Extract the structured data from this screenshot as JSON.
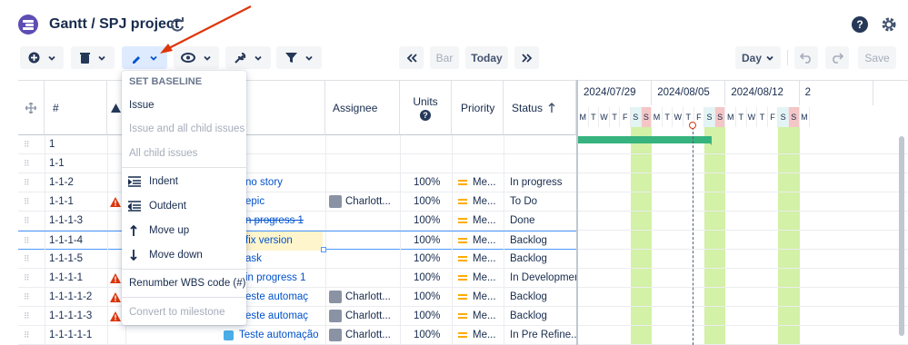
{
  "app": {
    "title": "Gantt / SPJ project"
  },
  "toolbar": {
    "today_label": "Today",
    "bar_label": "Bar",
    "zoom_label": "Day",
    "save_label": "Save"
  },
  "menu": {
    "section_title": "SET BASELINE",
    "items": [
      {
        "label": "Issue",
        "enabled": true
      },
      {
        "label": "Issue and all child issues",
        "enabled": false
      },
      {
        "label": "All child issues",
        "enabled": false
      },
      {
        "label": "Indent",
        "enabled": true,
        "icon": "indent-icon"
      },
      {
        "label": "Outdent",
        "enabled": true,
        "icon": "outdent-icon"
      },
      {
        "label": "Move up",
        "enabled": true,
        "icon": "arrow-up-icon"
      },
      {
        "label": "Move down",
        "enabled": true,
        "icon": "arrow-down-icon"
      },
      {
        "label": "Renumber WBS code (#)",
        "enabled": true
      },
      {
        "label": "Convert to milestone",
        "enabled": false
      }
    ]
  },
  "columns": {
    "num": "#",
    "assignee": "Assignee",
    "units": "Units",
    "priority": "Priority",
    "status": "Status"
  },
  "rows": [
    {
      "wbs": "1",
      "warn": false,
      "title": "",
      "assignee": "",
      "units": "",
      "priority": "",
      "status": ""
    },
    {
      "wbs": "1-1",
      "warn": false,
      "title": "",
      "assignee": "",
      "units": "",
      "priority": "",
      "status": ""
    },
    {
      "wbs": "1-1-2",
      "warn": false,
      "title": "no story",
      "assignee": "",
      "units": "100%",
      "priority": "Me...",
      "status": "In progress"
    },
    {
      "wbs": "1-1-1",
      "warn": true,
      "title": "epic",
      "assignee": "Charlott...",
      "units": "100%",
      "priority": "Me...",
      "status": "To Do"
    },
    {
      "wbs": "1-1-1-3",
      "warn": false,
      "title": "n progress 1",
      "strike": true,
      "assignee": "",
      "units": "100%",
      "priority": "Me...",
      "status": "Done"
    },
    {
      "wbs": "1-1-1-4",
      "warn": false,
      "title": "fix version",
      "assignee": "",
      "units": "100%",
      "priority": "Me...",
      "status": "Backlog"
    },
    {
      "wbs": "1-1-1-5",
      "warn": false,
      "title": "ask",
      "assignee": "",
      "units": "100%",
      "priority": "Me...",
      "status": "Backlog"
    },
    {
      "wbs": "1-1-1-1",
      "warn": true,
      "title": "in progress 1",
      "assignee": "",
      "units": "100%",
      "priority": "Me...",
      "status": "In Developmen"
    },
    {
      "wbs": "1-1-1-1-2",
      "warn": true,
      "title": "este automaç",
      "assignee": "Charlott...",
      "units": "100%",
      "priority": "Me...",
      "status": "Backlog"
    },
    {
      "wbs": "1-1-1-1-3",
      "warn": true,
      "title": "este automaç",
      "assignee": "Charlott...",
      "units": "100%",
      "priority": "Me...",
      "status": "Backlog"
    },
    {
      "wbs": "1-1-1-1-1",
      "warn": false,
      "title": "Teste automação",
      "assignee": "Charlott...",
      "units": "100%",
      "priority": "Me...",
      "status": "In Pre Refine..."
    }
  ],
  "gantt": {
    "weeks": [
      "2024/07/29",
      "2024/08/05",
      "2024/08/12",
      "2"
    ],
    "days": [
      "M",
      "T",
      "W",
      "T",
      "F",
      "S",
      "S",
      "M",
      "T",
      "W",
      "T",
      "F",
      "S",
      "S",
      "M",
      "T",
      "W",
      "T",
      "F",
      "S",
      "S",
      "M"
    ]
  },
  "colors": {
    "accent": "#0052cc",
    "weekend_a": "#d3f1a7",
    "bar": "#36b37e",
    "arrow": "#de350b"
  }
}
